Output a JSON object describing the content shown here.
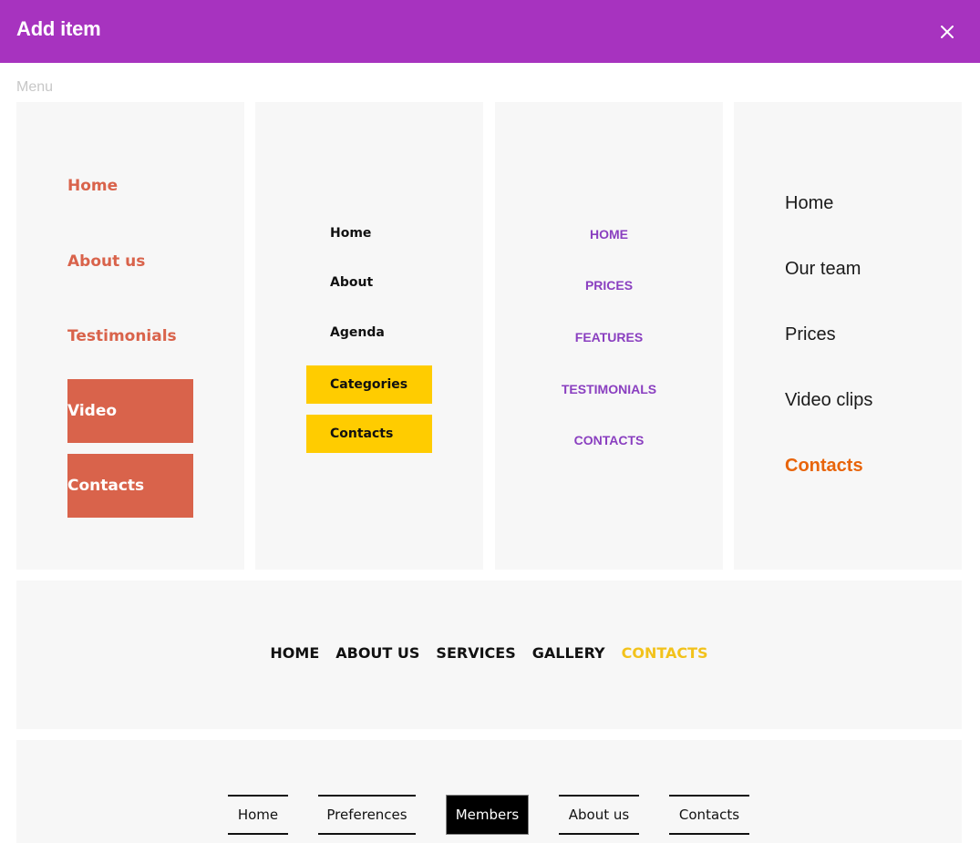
{
  "dialog": {
    "title": "Add item",
    "section_label": "Menu"
  },
  "menus": {
    "style1": {
      "links": [
        "Home",
        "About us",
        "Testimonials"
      ],
      "buttons": [
        "Video",
        "Contacts"
      ],
      "colors": {
        "accent": "#d9634b",
        "button_text": "#ffffff"
      }
    },
    "style2": {
      "links": [
        "Home",
        "About",
        "Agenda"
      ],
      "buttons": [
        "Categories",
        "Contacts"
      ],
      "colors": {
        "button_bg": "#ffcc00",
        "text": "#111111"
      }
    },
    "style3": {
      "links": [
        "HOME",
        "PRICES",
        "FEATURES",
        "TESTIMONIALS",
        "CONTACTS"
      ],
      "colors": {
        "text": "#8a3fc0"
      }
    },
    "style4": {
      "links": [
        "Home",
        "Our team",
        "Prices",
        "Video clips"
      ],
      "active": "Contacts",
      "colors": {
        "text": "#1a1a1a",
        "active": "#e8640a"
      }
    },
    "style5": {
      "links": [
        "HOME",
        "ABOUT US",
        "SERVICES",
        "GALLERY"
      ],
      "active": "CONTACTS",
      "colors": {
        "text": "#111111",
        "active": "#f2c21b"
      }
    },
    "style6": {
      "links": [
        "Home",
        "Preferences",
        "Members",
        "About us",
        "Contacts"
      ],
      "active_index": 2,
      "colors": {
        "active_bg": "#000000",
        "active_text": "#ffffff"
      }
    }
  },
  "colors": {
    "header_bg": "#a733bf",
    "card_bg": "#f7f7f7"
  },
  "icons": {
    "close": "close-icon"
  }
}
